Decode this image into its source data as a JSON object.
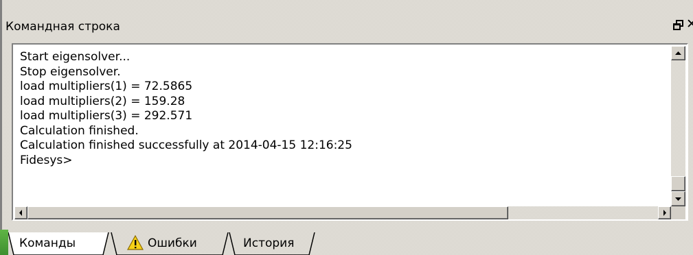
{
  "panel": {
    "title": "Командная строка"
  },
  "console": {
    "lines": [
      "Start eigensolver...",
      "Stop eigensolver.",
      "load multipliers(1) = 72.5865",
      "load multipliers(2) = 159.28",
      "load multipliers(3) = 292.571",
      "Calculation finished.",
      "Calculation finished successfully at 2014-04-15 12:16:25",
      "Fidesys>"
    ]
  },
  "tabs": [
    {
      "label": "Команды",
      "icon": null,
      "active": true
    },
    {
      "label": "Ошибки",
      "icon": "warning-icon",
      "active": false
    },
    {
      "label": "История",
      "icon": null,
      "active": false
    }
  ],
  "icons": {
    "float": "float-window-icon",
    "close": "close-icon"
  }
}
